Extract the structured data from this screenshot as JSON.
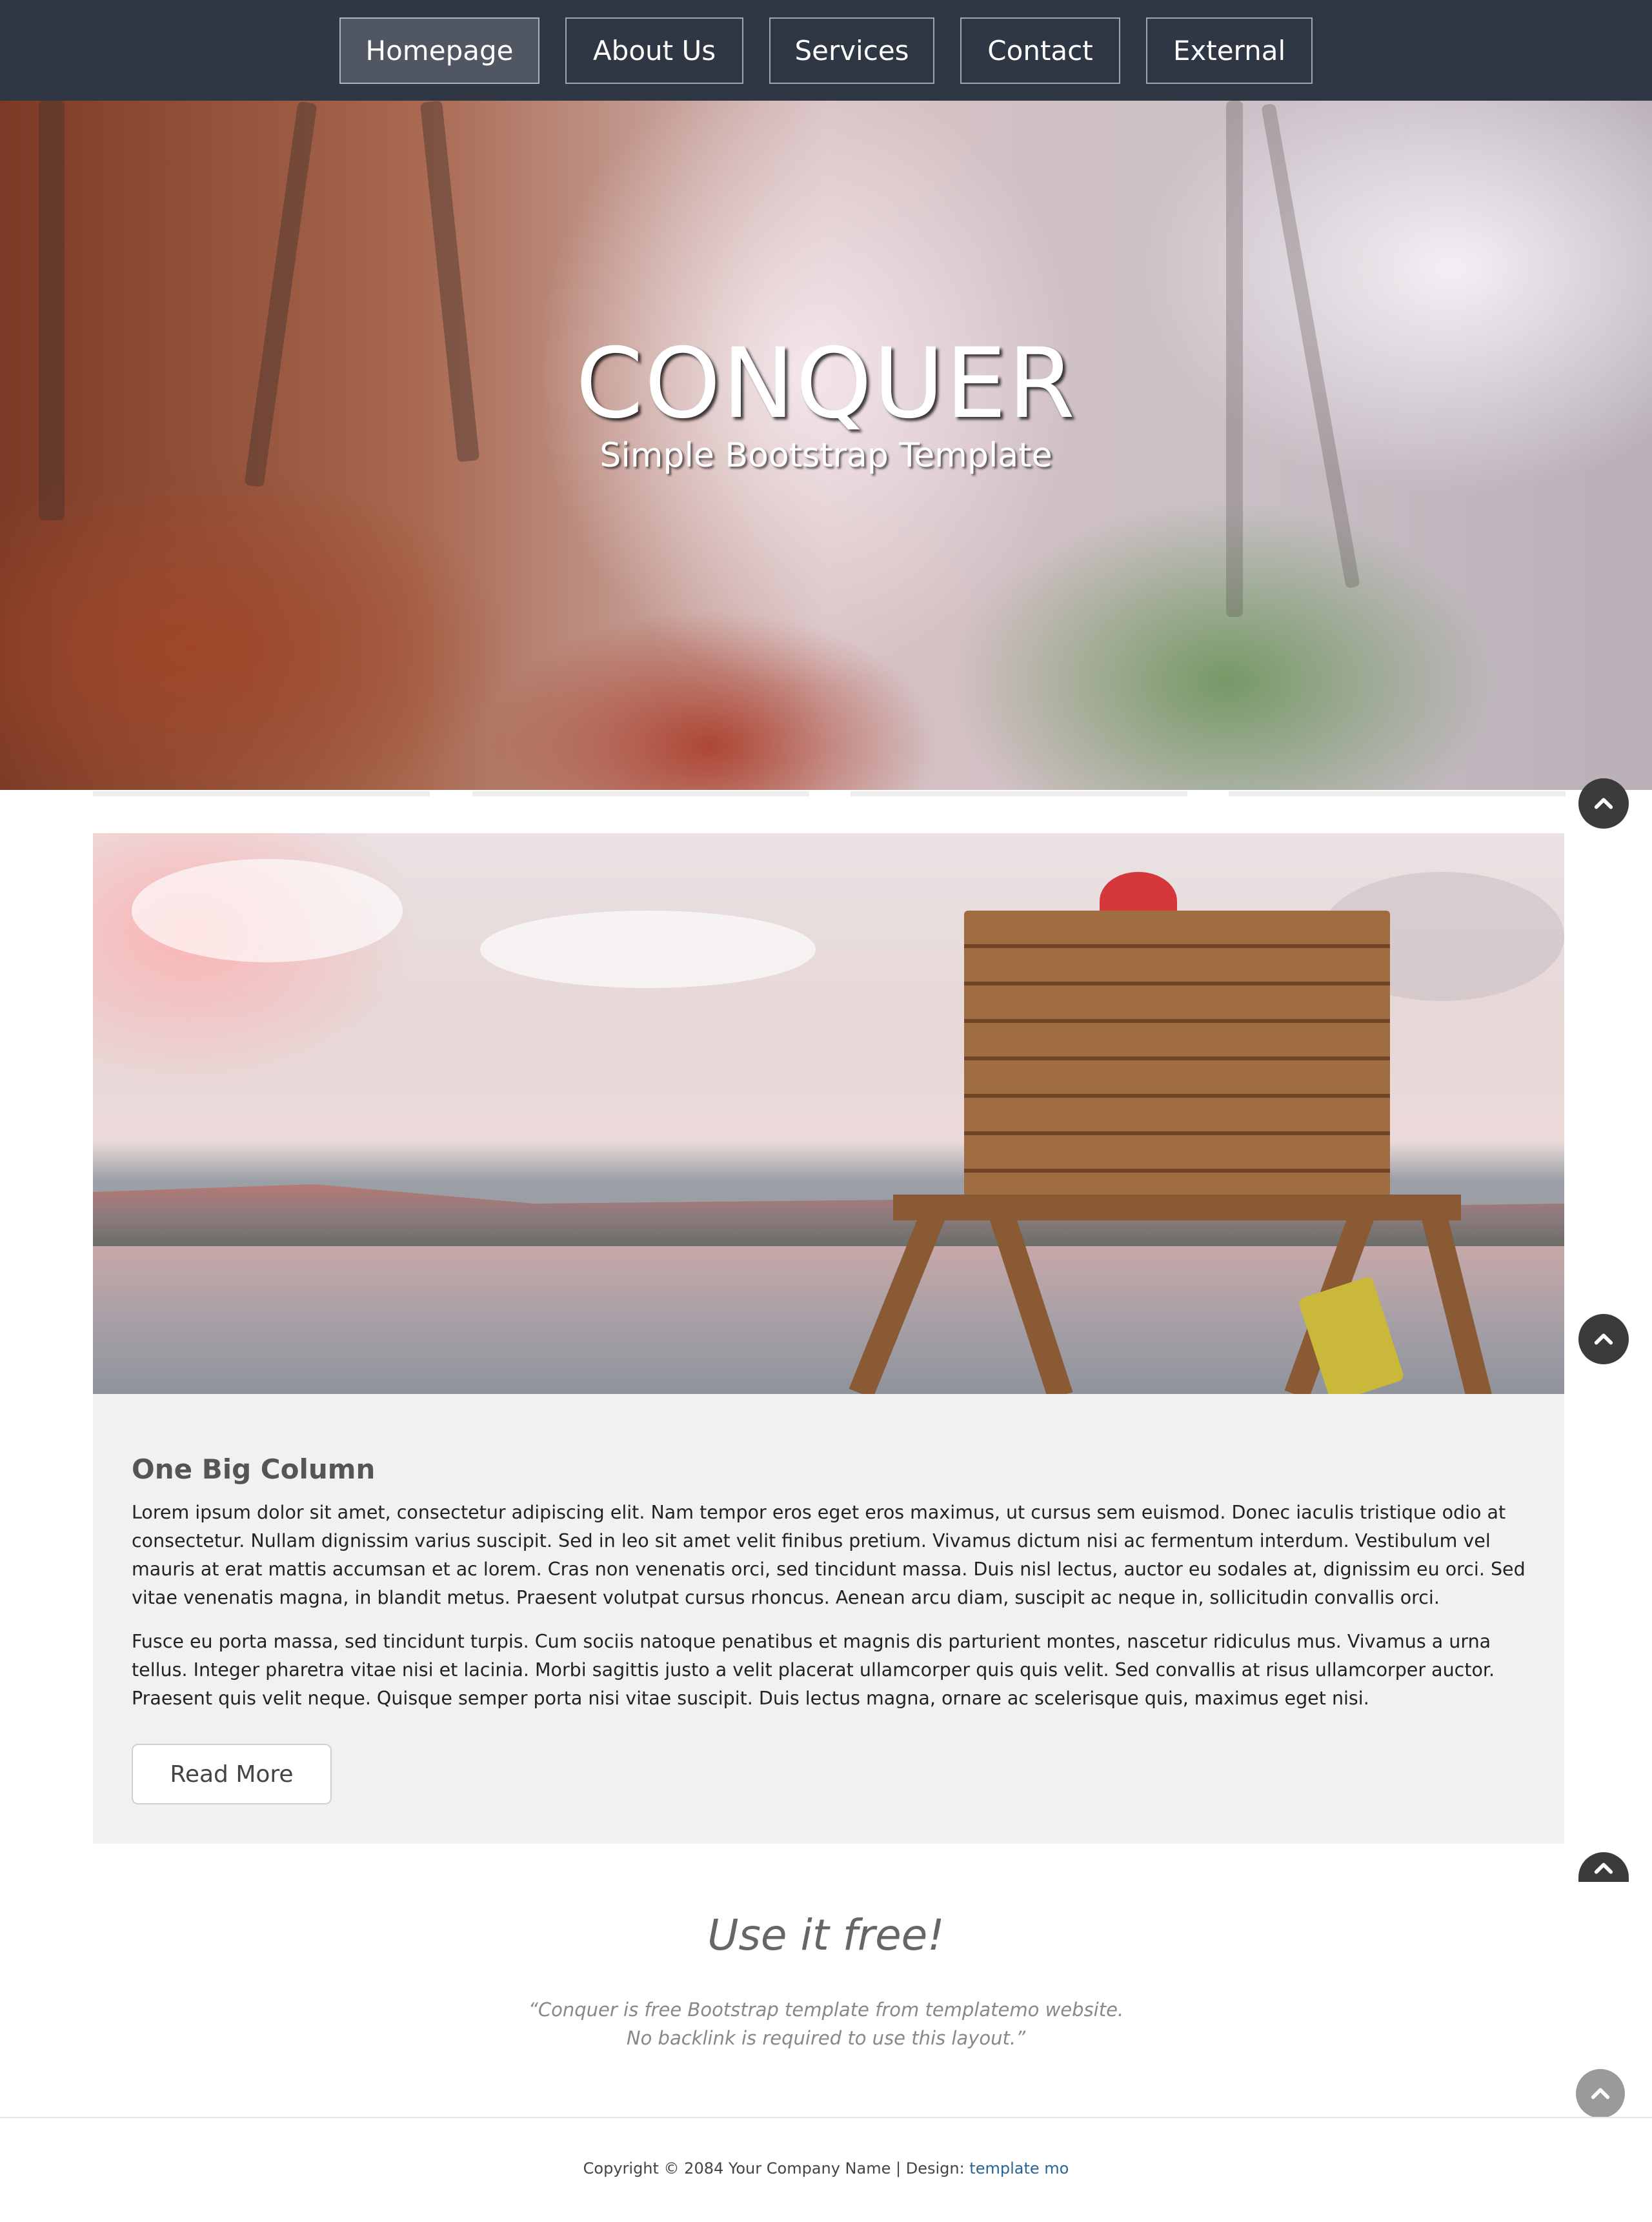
{
  "nav": {
    "items": [
      {
        "label": "Homepage",
        "active": true
      },
      {
        "label": "About Us",
        "active": false
      },
      {
        "label": "Services",
        "active": false
      },
      {
        "label": "Contact",
        "active": false
      },
      {
        "label": "External",
        "active": false
      }
    ]
  },
  "hero": {
    "title": "CONQUER",
    "subtitle": "Simple Bootstrap Template"
  },
  "content": {
    "heading": "One Big Column",
    "paragraph1": "Lorem ipsum dolor sit amet, consectetur adipiscing elit. Nam tempor eros eget eros maximus, ut cursus sem euismod. Donec iaculis tristique odio at consectetur. Nullam dignissim varius suscipit. Sed in leo sit amet velit finibus pretium. Vivamus dictum nisi ac fermentum interdum. Vestibulum vel mauris at erat mattis accumsan et ac lorem. Cras non venenatis orci, sed tincidunt massa. Duis nisl lectus, auctor eu sodales at, dignissim eu orci. Sed vitae venenatis magna, in blandit metus. Praesent volutpat cursus rhoncus. Aenean arcu diam, suscipit ac neque in, sollicitudin convallis orci.",
    "paragraph2": "Fusce eu porta massa, sed tincidunt turpis. Cum sociis natoque penatibus et magnis dis parturient montes, nascetur ridiculus mus. Vivamus a urna tellus. Integer pharetra vitae nisi et lacinia. Morbi sagittis justo a velit placerat ullamcorper quis quis velit. Sed convallis at risus ullamcorper auctor. Praesent quis velit neque. Quisque semper porta nisi vitae suscipit. Duis lectus magna, ornare ac scelerisque quis, maximus eget nisi.",
    "button": "Read More"
  },
  "quote": {
    "title": "Use it free!",
    "line1": "“Conquer is free Bootstrap template from templatemo website.",
    "line2": "No backlink is required to use this layout.”"
  },
  "footer": {
    "text": "Copyright © 2084 Your Company Name | Design: ",
    "link": "template mo"
  },
  "icons": {
    "scroll_top": "chevron-up-icon"
  },
  "colors": {
    "navbar": "#2f3644",
    "content_bg": "#f1f1f1",
    "scroll_button": "#3b3b3b",
    "link": "#2a6496"
  }
}
